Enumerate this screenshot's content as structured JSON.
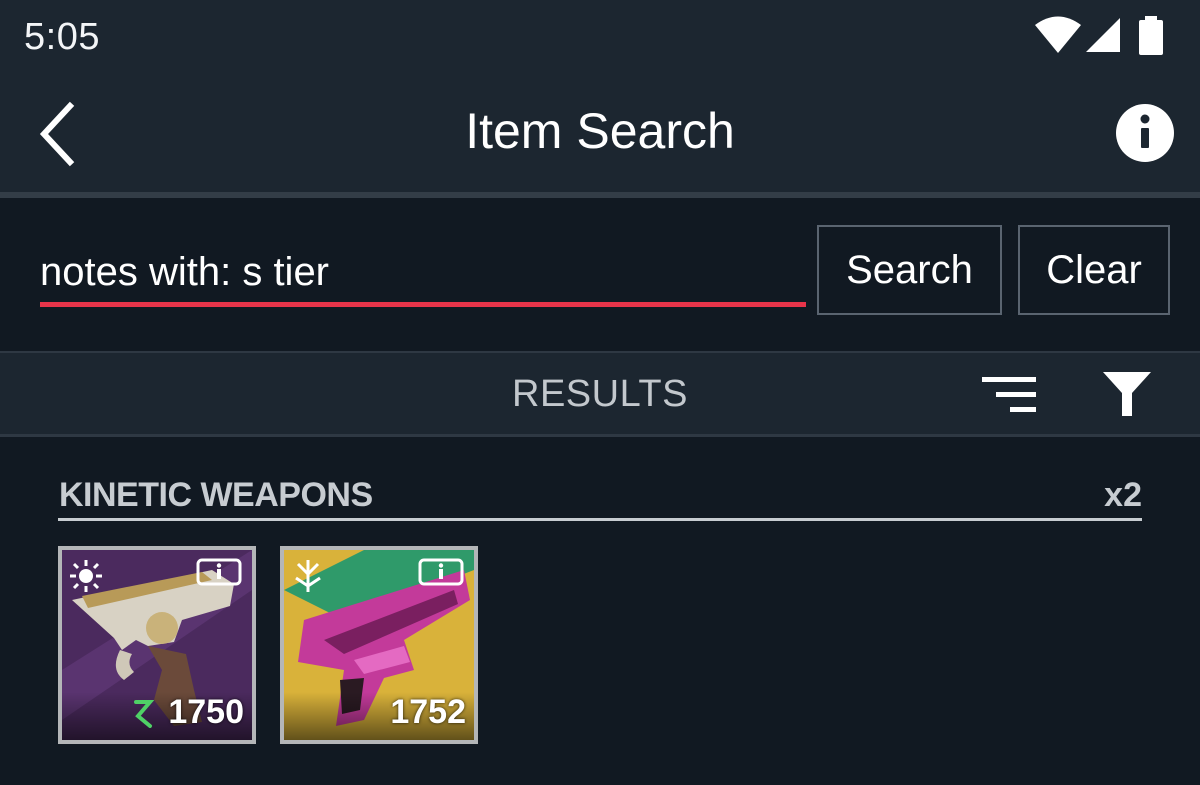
{
  "status_bar": {
    "time": "5:05",
    "icons": [
      "wifi-icon",
      "signal-icon",
      "battery-icon"
    ]
  },
  "app_bar": {
    "title": "Item Search",
    "back_icon": "chevron-left-icon",
    "info_icon": "info-circle-icon"
  },
  "search": {
    "value": "notes with: s tier",
    "search_label": "Search",
    "clear_label": "Clear",
    "accent_color": "#e8344a"
  },
  "results": {
    "label": "RESULTS",
    "sort_icon": "sort-icon",
    "filter_icon": "filter-icon"
  },
  "section": {
    "title": "KINETIC WEAPONS",
    "count": "x2",
    "items": [
      {
        "power": "1750",
        "background": "#4b2a5e",
        "crafted": true,
        "icons": [
          "info-badge-icon",
          "solar-element-icon",
          "crafted-icon"
        ]
      },
      {
        "power": "1752",
        "background": "#d9b23a",
        "crafted": false,
        "icons": [
          "info-badge-icon",
          "season-emblem-icon"
        ]
      }
    ]
  },
  "colors": {
    "background": "#111922",
    "bar": "#1c2630",
    "text_secondary": "#c7ccd1"
  }
}
